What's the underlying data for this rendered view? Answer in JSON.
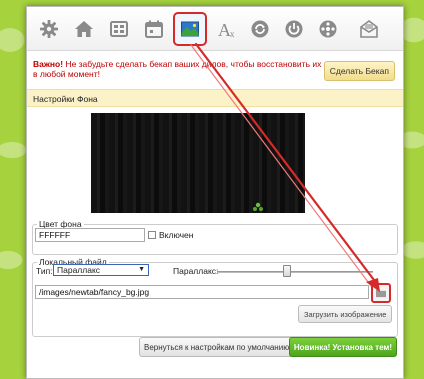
{
  "toolbar": {
    "buttons": [
      {
        "name": "settings",
        "icon": "gear-icon"
      },
      {
        "name": "home",
        "icon": "home-icon"
      },
      {
        "name": "dials",
        "icon": "dials-icon"
      },
      {
        "name": "calendar",
        "icon": "calendar-icon"
      },
      {
        "name": "background",
        "icon": "image-icon",
        "active": true
      },
      {
        "name": "fonts",
        "icon": "font-icon"
      },
      {
        "name": "sync",
        "icon": "sync-icon"
      },
      {
        "name": "power",
        "icon": "power-icon"
      },
      {
        "name": "gallery",
        "icon": "gallery-icon"
      },
      {
        "name": "mail",
        "icon": "mail-icon"
      }
    ]
  },
  "notice": {
    "prefix": "Важно!",
    "text": " Не забудьте сделать бекап ваших дилов, чтобы восстановить их в любой момент!"
  },
  "backup_button": "Сделать Бекап",
  "section_title": "Настройки Фона",
  "color_group": {
    "legend": "Цвет фона",
    "value": "FFFFFF",
    "checkbox_label": "Включен"
  },
  "file_group": {
    "legend": "Локальный файл",
    "type_label": "Тип:",
    "type_value": "Параллакс",
    "parallax_label": "Параллакс:",
    "parallax_value": 0.45,
    "path": "/images/newtab/fancy_bg.jpg",
    "upload_button": "Загрузить изображение"
  },
  "footer": {
    "default_button": "Вернуться к настройкам по умолчанию",
    "new_button": "Новинка! Установка тем!"
  },
  "colors": {
    "accent_red": "#d62a2a",
    "green_button": "#5cb82a",
    "notice_red": "#c00000",
    "section_bg": "#fbf2c8"
  }
}
